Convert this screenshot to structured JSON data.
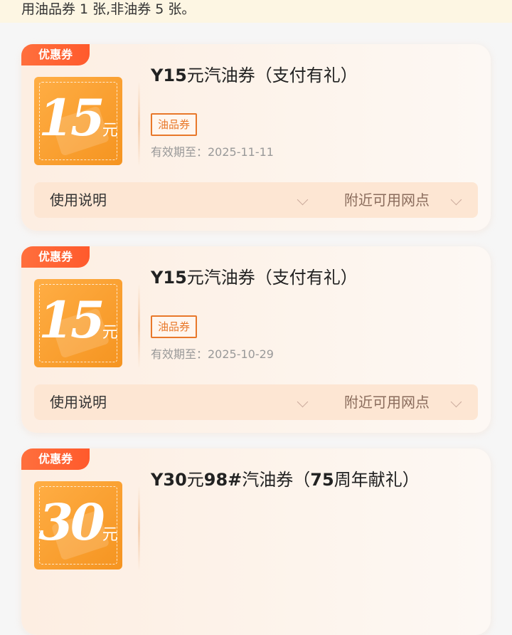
{
  "notice": {
    "text": "用油品券 1 张,非油券 5 张。"
  },
  "coupons": [
    {
      "ribbon": "优惠券",
      "amount": "15",
      "unit": "元",
      "title_prefix": "Y15",
      "title_rest": "元汽油券（支付有礼）",
      "tag": "油品券",
      "validity": "有效期至：2025-11-11",
      "usage_label": "使用说明",
      "nearby_label": "附近可用网点"
    },
    {
      "ribbon": "优惠券",
      "amount": "15",
      "unit": "元",
      "title_prefix": "Y15",
      "title_rest": "元汽油券（支付有礼）",
      "tag": "油品券",
      "validity": "有效期至：2025-10-29",
      "usage_label": "使用说明",
      "nearby_label": "附近可用网点"
    },
    {
      "ribbon": "优惠券",
      "amount": "30",
      "unit": "元",
      "title_parts": [
        "Y30",
        "元",
        "98#",
        "汽油券（",
        "75",
        "周年献礼）"
      ]
    }
  ],
  "colors": {
    "ribbon": "#ff5a2c",
    "coupon_box": "#f59420",
    "tag": "#e8782a",
    "notice_bg": "#fdf6e3"
  },
  "icons": [
    "chevron-down-icon"
  ]
}
